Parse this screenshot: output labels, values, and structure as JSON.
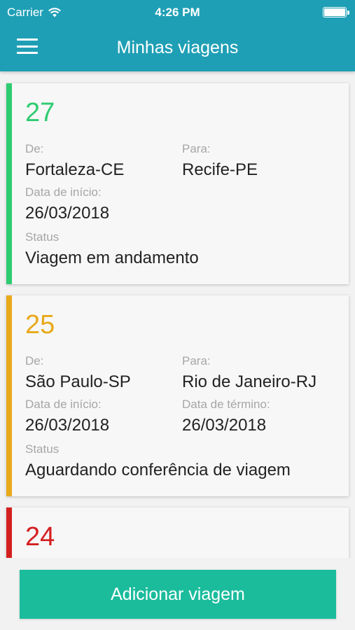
{
  "status_bar": {
    "carrier": "Carrier",
    "time": "4:26 PM"
  },
  "header": {
    "title": "Minhas viagens",
    "menu_icon": "hamburger-menu-icon"
  },
  "colors": {
    "header": "#1f9fb5",
    "button": "#1abc9c",
    "in_progress": "#2ecc71",
    "pending": "#e8a91a",
    "other": "#d41f1f"
  },
  "trips": [
    {
      "number": "27",
      "from_label": "De:",
      "from": "Fortaleza-CE",
      "to_label": "Para:",
      "to": "Recife-PE",
      "start_label": "Data de início:",
      "start": "26/03/2018",
      "status_label": "Status",
      "status": "Viagem em andamento"
    },
    {
      "number": "25",
      "from_label": "De:",
      "from": "São Paulo-SP",
      "to_label": "Para:",
      "to": "Rio de Janeiro-RJ",
      "start_label": "Data de início:",
      "start": "26/03/2018",
      "end_label": "Data de término:",
      "end": "26/03/2018",
      "status_label": "Status",
      "status": "Aguardando conferência de viagem"
    },
    {
      "number": "24"
    }
  ],
  "footer": {
    "add_button": "Adicionar viagem"
  }
}
